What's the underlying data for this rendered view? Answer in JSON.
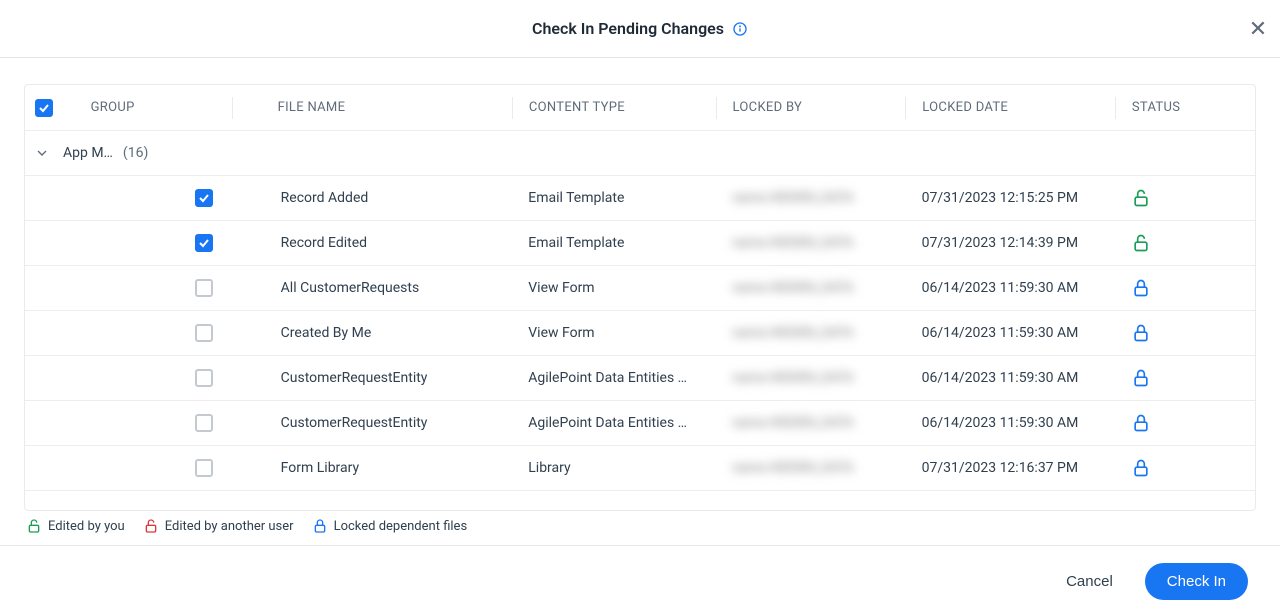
{
  "dialog": {
    "title": "Check In Pending Changes",
    "close_aria": "Close"
  },
  "columns": {
    "group": "GROUP",
    "file_name": "FILE NAME",
    "content_type": "CONTENT TYPE",
    "locked_by": "LOCKED BY",
    "locked_date": "LOCKED DATE",
    "status": "STATUS"
  },
  "group": {
    "name": "App M…",
    "count": "(16)"
  },
  "rows": [
    {
      "checked": true,
      "file_name": "Record Added",
      "content_type": "Email Template",
      "locked_by": "name.HIDDEN_DATA",
      "locked_date": "07/31/2023 12:15:25 PM",
      "status_color": "green"
    },
    {
      "checked": true,
      "file_name": "Record Edited",
      "content_type": "Email Template",
      "locked_by": "name.HIDDEN_DATA",
      "locked_date": "07/31/2023 12:14:39 PM",
      "status_color": "green"
    },
    {
      "checked": false,
      "file_name": "All CustomerRequests",
      "content_type": "View Form",
      "locked_by": "name.HIDDEN_DATA",
      "locked_date": "06/14/2023 11:59:30 AM",
      "status_color": "blue"
    },
    {
      "checked": false,
      "file_name": "Created By Me",
      "content_type": "View Form",
      "locked_by": "name.HIDDEN_DATA",
      "locked_date": "06/14/2023 11:59:30 AM",
      "status_color": "blue"
    },
    {
      "checked": false,
      "file_name": "CustomerRequestEntity",
      "content_type": "AgilePoint Data Entities …",
      "locked_by": "name.HIDDEN_DATA",
      "locked_date": "06/14/2023 11:59:30 AM",
      "status_color": "blue"
    },
    {
      "checked": false,
      "file_name": "CustomerRequestEntity",
      "content_type": "AgilePoint Data Entities …",
      "locked_by": "name.HIDDEN_DATA",
      "locked_date": "06/14/2023 11:59:30 AM",
      "status_color": "blue"
    },
    {
      "checked": false,
      "file_name": "Form Library",
      "content_type": "Library",
      "locked_by": "name.HIDDEN_DATA",
      "locked_date": "07/31/2023 12:16:37 PM",
      "status_color": "blue"
    }
  ],
  "legend": {
    "you": "Edited by you",
    "other": "Edited by another user",
    "dep": "Locked dependent files"
  },
  "footer": {
    "cancel": "Cancel",
    "checkin": "Check In"
  },
  "colors": {
    "green": "#1a9e57",
    "blue": "#1976f2",
    "red": "#d63a3a"
  }
}
